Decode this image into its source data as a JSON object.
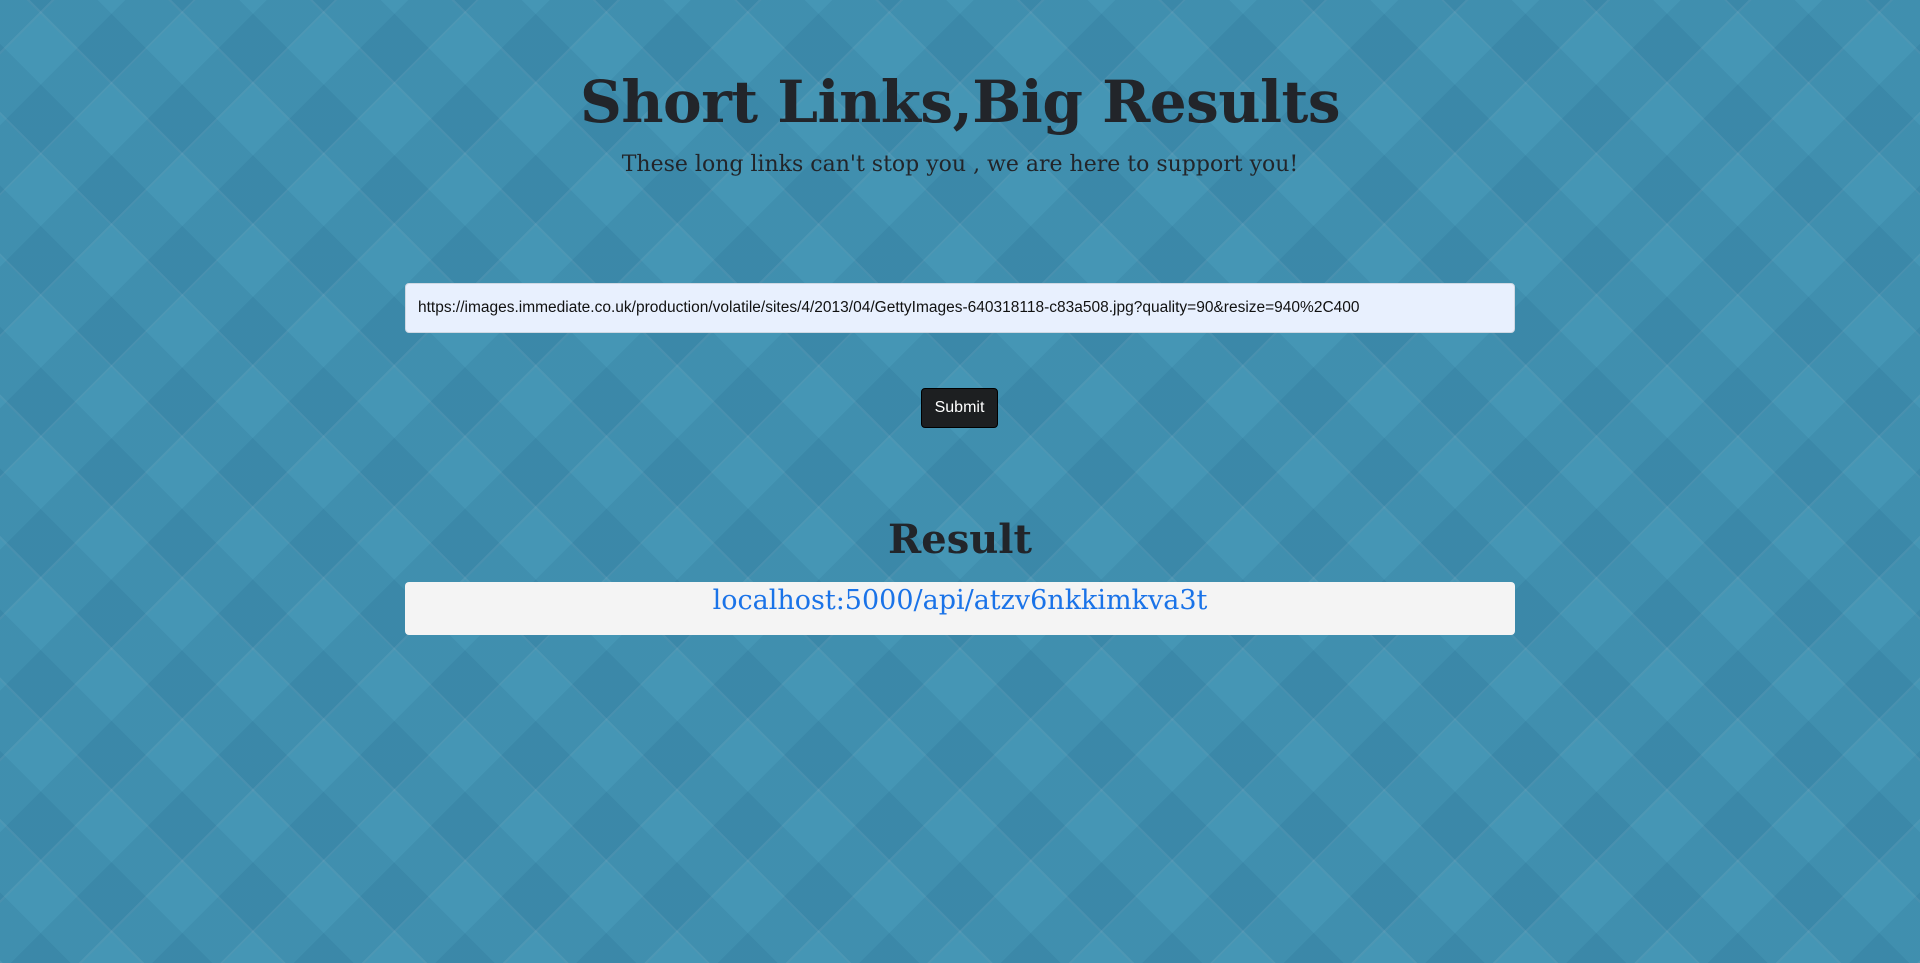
{
  "header": {
    "title": "Short Links,Big Results",
    "subtitle": "These long links can't stop you , we are here to support you!"
  },
  "form": {
    "url_value": "https://images.immediate.co.uk/production/volatile/sites/4/2013/04/GettyImages-640318118-c83a508.jpg?quality=90&resize=940%2C400",
    "submit_label": "Submit"
  },
  "result": {
    "heading": "Result",
    "short_link": "localhost:5000/api/atzv6nkkimkva3t"
  },
  "colors": {
    "background": "#4596b5",
    "input_background": "#e8f0fe",
    "button_background": "#1d1f21",
    "link": "#1a73e8",
    "result_box": "#f4f4f4"
  }
}
